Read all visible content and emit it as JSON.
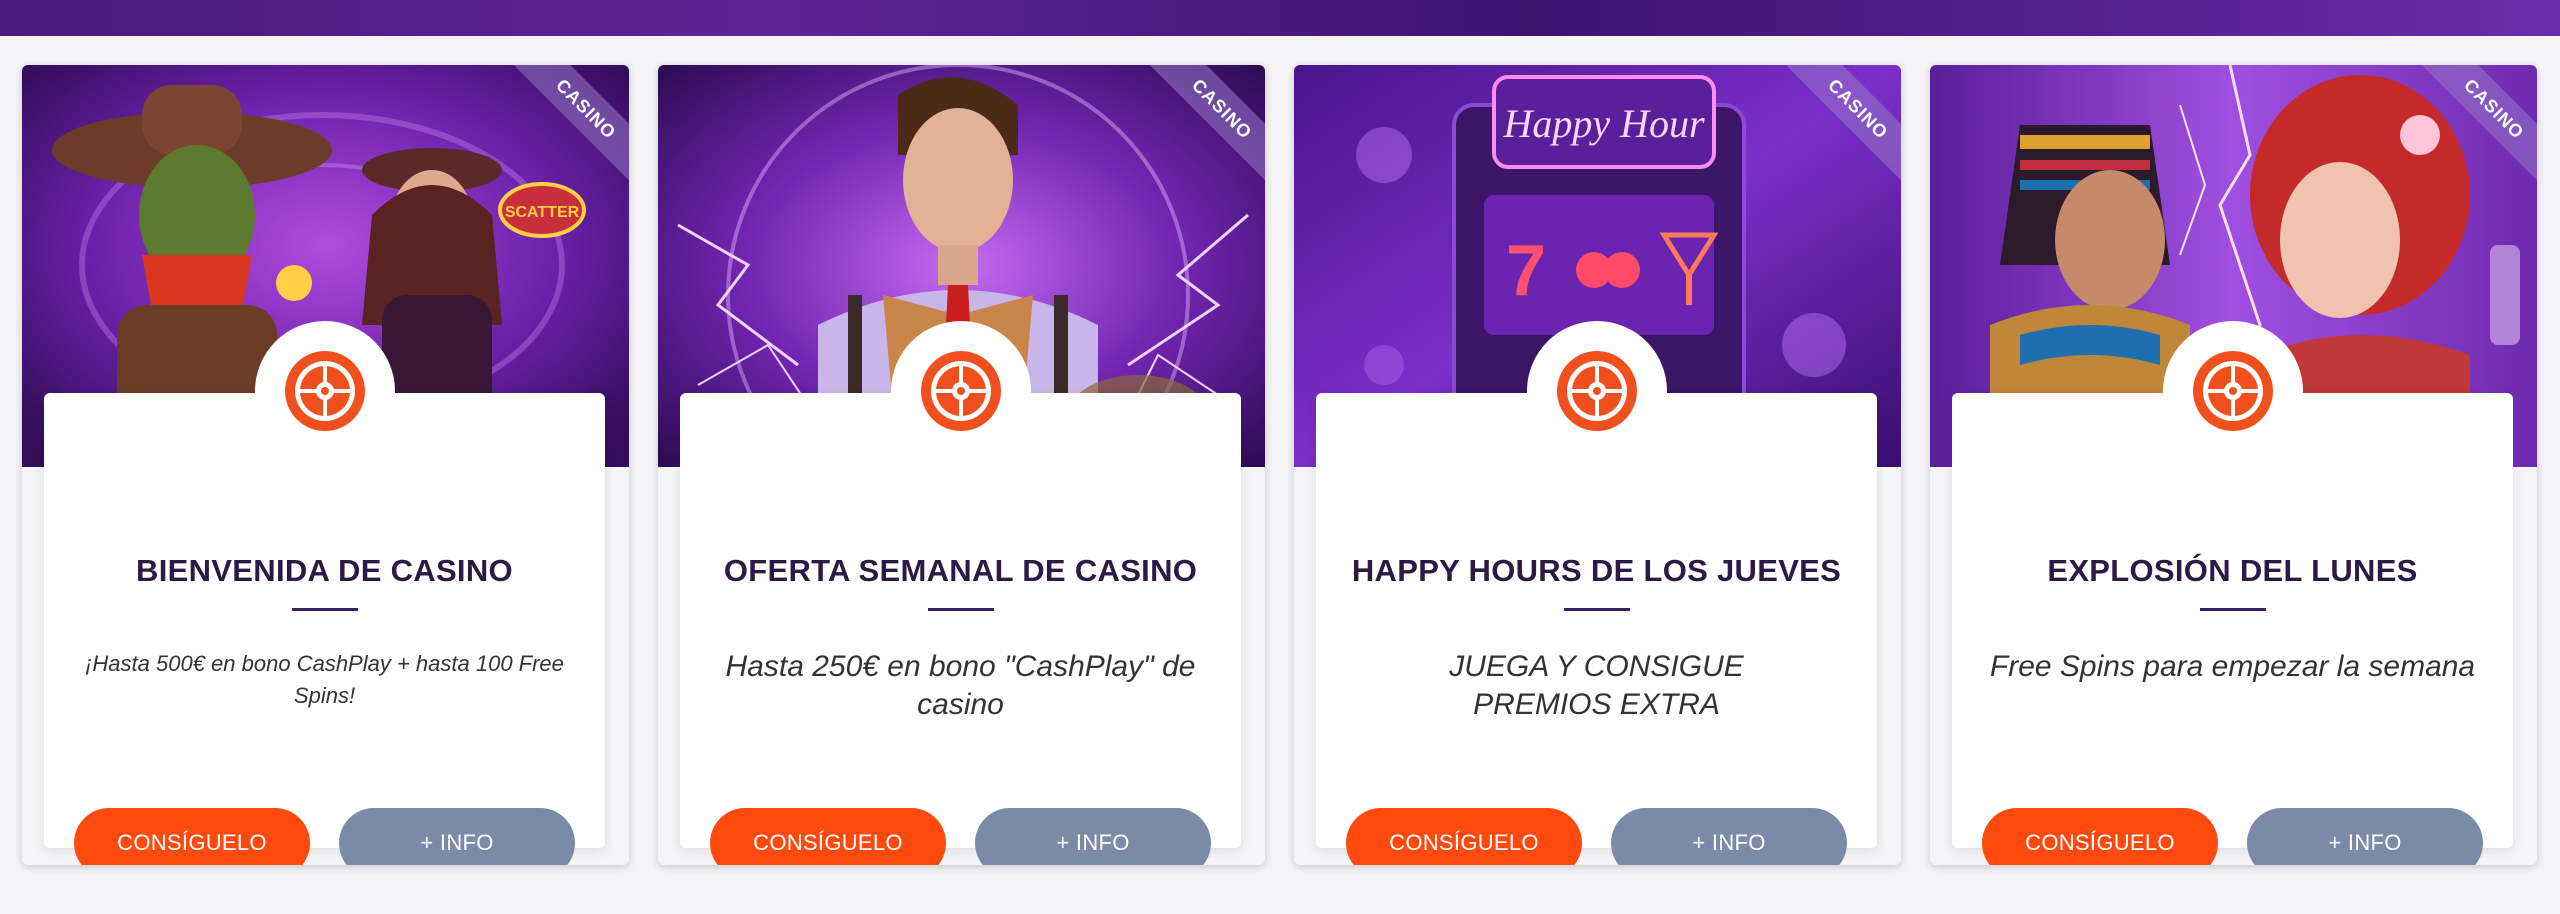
{
  "colors": {
    "banner": "#4a1a7a",
    "primary_button": "#ff4a0f",
    "info_button": "#7a8ba8",
    "title": "#2b1a45",
    "logo": "#f0501e"
  },
  "cards": [
    {
      "badge": "CASINO",
      "image_icon": "western-cowboy-slot-artwork",
      "title": "BIENVENIDA DE CASINO",
      "description": "¡Hasta 500€ en bono CashPlay + hasta 100 Free Spins!",
      "primary_label": "CONSÍGUELO",
      "info_label": "+ INFO"
    },
    {
      "badge": "CASINO",
      "image_icon": "man-with-lightning-artwork",
      "title": "OFERTA SEMANAL DE CASINO",
      "description": "Hasta 250€ en bono \"CashPlay\" de casino",
      "primary_label": "CONSÍGUELO",
      "info_label": "+ INFO"
    },
    {
      "badge": "CASINO",
      "image_icon": "happy-hour-slot-machine-artwork",
      "image_text": "Happy Hour",
      "title": "HAPPY HOURS DE LOS JUEVES",
      "description": "JUEGA Y CONSIGUE PREMIOS EXTRA",
      "primary_label": "CONSÍGUELO",
      "info_label": "+ INFO"
    },
    {
      "badge": "CASINO",
      "image_icon": "two-women-faceoff-artwork",
      "title": "EXPLOSIÓN DEL LUNES",
      "description": "Free Spins para empezar la semana",
      "primary_label": "CONSÍGUELO",
      "info_label": "+ INFO"
    }
  ]
}
